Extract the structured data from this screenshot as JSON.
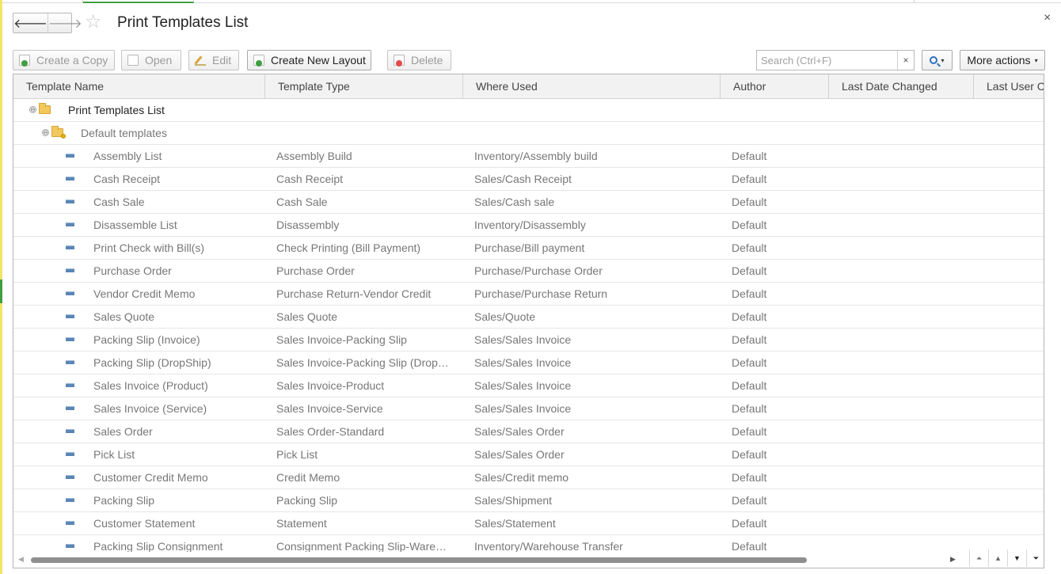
{
  "window": {
    "title": "Print Templates List",
    "close_glyph": "×",
    "back_glyph": "🡐",
    "forward_glyph": "🡒",
    "star_glyph": "☆"
  },
  "toolbar": {
    "create_copy": "Create a Copy",
    "open": "Open",
    "edit": "Edit",
    "create_new_layout": "Create New Layout",
    "delete": "Delete",
    "search_placeholder": "Search (Ctrl+F)",
    "search_clear": "×",
    "search_caret": "▾",
    "more_actions": "More actions",
    "more_caret": "▾"
  },
  "icons": {
    "copy": "copy-icon",
    "open": "open-icon",
    "edit": "edit-icon",
    "new_layout": "new-layout-icon",
    "delete": "delete-icon",
    "search": "search-icon",
    "folder": "folder-icon",
    "item": "template-item-icon"
  },
  "colors": {
    "accent_green": "#3f9e3f",
    "delete_red": "#e34b4b",
    "link_blue": "#2f6fbf"
  },
  "table": {
    "columns": [
      "Template Name",
      "Template Type",
      "Where Used",
      "Author",
      "Last Date Changed",
      "Last User Ch"
    ],
    "tree_toggle": "⊖",
    "root_group": "Print Templates List",
    "sub_group": "Default templates",
    "rows": [
      {
        "name": "Assembly List",
        "type": "Assembly Build",
        "where": "Inventory/Assembly build",
        "author": "Default"
      },
      {
        "name": "Cash Receipt",
        "type": "Cash Receipt",
        "where": "Sales/Cash Receipt",
        "author": "Default"
      },
      {
        "name": "Cash Sale",
        "type": "Cash Sale",
        "where": "Sales/Cash sale",
        "author": "Default"
      },
      {
        "name": "Disassemble List",
        "type": "Disassembly",
        "where": "Inventory/Disassembly",
        "author": "Default"
      },
      {
        "name": "Print Check with Bill(s)",
        "type": "Check Printing (Bill Payment)",
        "where": "Purchase/Bill payment",
        "author": "Default"
      },
      {
        "name": "Purchase Order",
        "type": "Purchase Order",
        "where": "Purchase/Purchase Order",
        "author": "Default"
      },
      {
        "name": "Vendor Credit Memo",
        "type": "Purchase Return-Vendor Credit",
        "where": "Purchase/Purchase Return",
        "author": "Default"
      },
      {
        "name": "Sales Quote",
        "type": "Sales Quote",
        "where": "Sales/Quote",
        "author": "Default"
      },
      {
        "name": "Packing Slip (Invoice)",
        "type": "Sales Invoice-Packing Slip",
        "where": "Sales/Sales Invoice",
        "author": "Default"
      },
      {
        "name": "Packing Slip (DropShip)",
        "type": "Sales Invoice-Packing Slip (DropS…",
        "where": "Sales/Sales Invoice",
        "author": "Default"
      },
      {
        "name": "Sales Invoice (Product)",
        "type": "Sales Invoice-Product",
        "where": "Sales/Sales Invoice",
        "author": "Default"
      },
      {
        "name": "Sales Invoice (Service)",
        "type": "Sales Invoice-Service",
        "where": "Sales/Sales Invoice",
        "author": "Default"
      },
      {
        "name": "Sales Order",
        "type": "Sales Order-Standard",
        "where": "Sales/Sales Order",
        "author": "Default"
      },
      {
        "name": "Pick List",
        "type": "Pick List",
        "where": "Sales/Sales Order",
        "author": "Default"
      },
      {
        "name": "Customer Credit Memo",
        "type": "Credit Memo",
        "where": "Sales/Credit memo",
        "author": "Default"
      },
      {
        "name": "Packing Slip",
        "type": "Packing Slip",
        "where": "Sales/Shipment",
        "author": "Default"
      },
      {
        "name": "Customer Statement",
        "type": "Statement",
        "where": "Sales/Statement",
        "author": "Default"
      },
      {
        "name": "Packing Slip Consignment",
        "type": "Consignment Packing Slip-Wareho…",
        "where": "Inventory/Warehouse Transfer",
        "author": "Default"
      }
    ]
  },
  "scroll": {
    "left_glyph": "◀",
    "right_glyph": "▶",
    "nav": [
      "⏶",
      "▲",
      "▼",
      "⏷"
    ]
  }
}
